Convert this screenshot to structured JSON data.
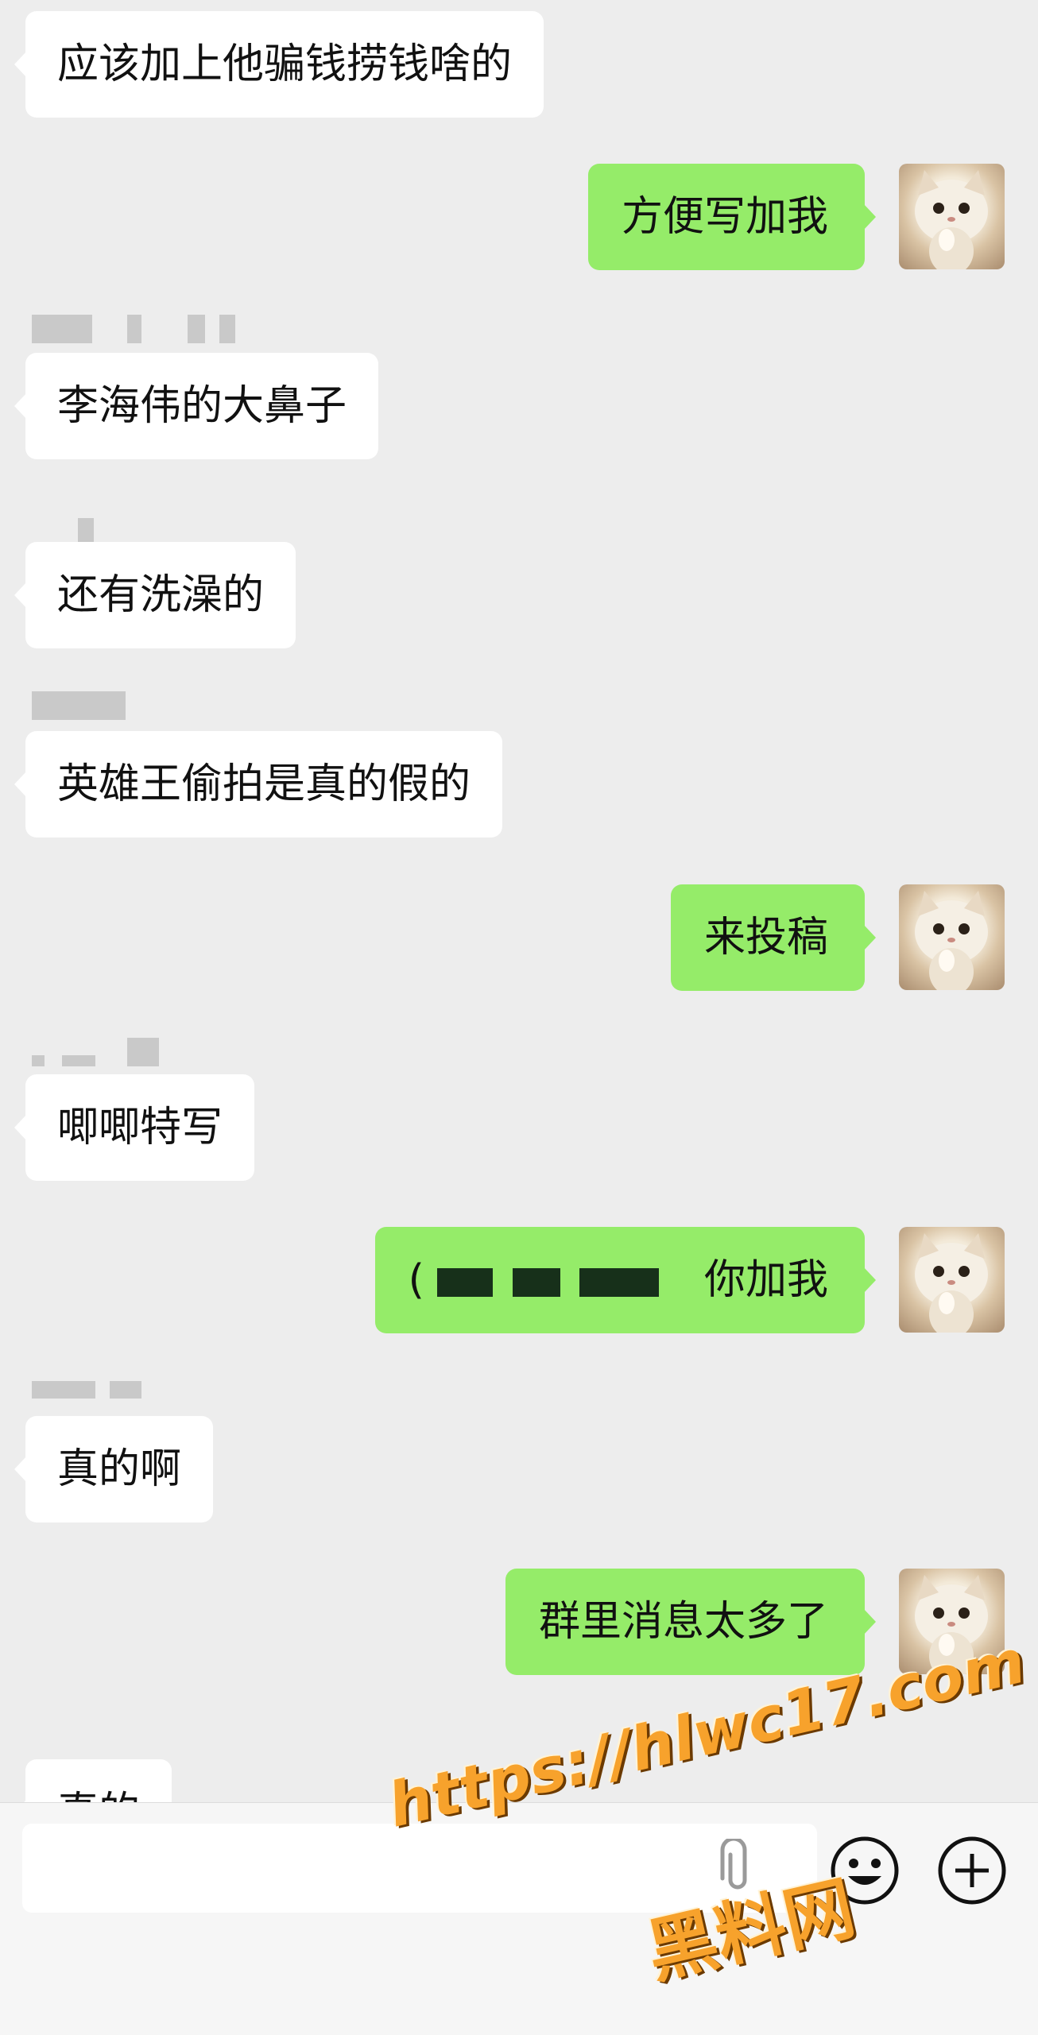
{
  "messages": [
    {
      "text": "应该加上他骗钱捞钱啥的"
    },
    {
      "text": "方便写加我"
    },
    {
      "text": "李海伟的大鼻子"
    },
    {
      "text": "还有洗澡的"
    },
    {
      "text": "英雄王偷拍是真的假的"
    },
    {
      "text": "来投稿"
    },
    {
      "text": "唧唧特写"
    },
    {
      "text": "你加我",
      "prefix": "("
    },
    {
      "text": "真的啊"
    },
    {
      "text": "群里消息太多了"
    },
    {
      "text": "真的"
    }
  ],
  "colors": {
    "outgoing_bubble": "#95ec69",
    "incoming_bubble": "#ffffff",
    "background": "#ededed",
    "watermark": "#f7a22c"
  },
  "input_bar": {
    "icons": [
      "paperclip-icon",
      "emoji-icon",
      "plus-icon"
    ]
  },
  "watermark": {
    "url": "https://hlwc17.com",
    "label": "黑料网"
  }
}
